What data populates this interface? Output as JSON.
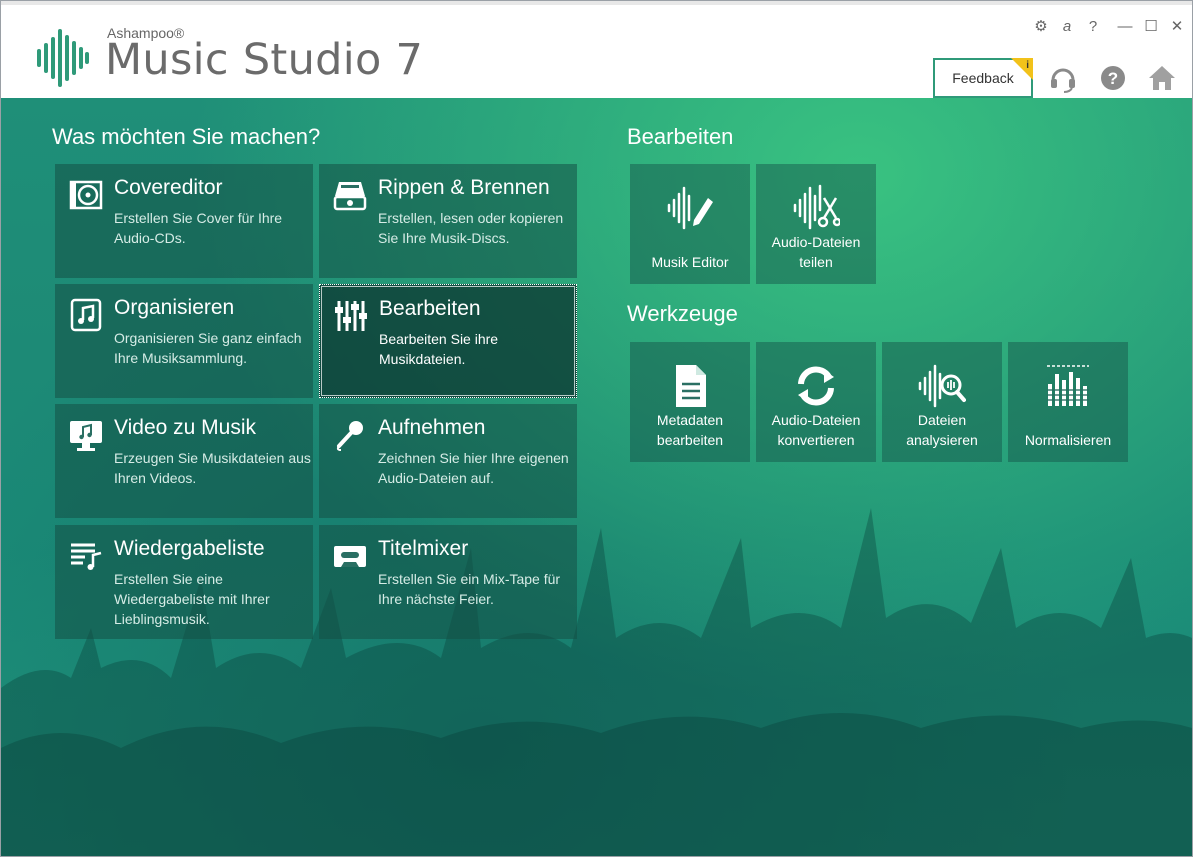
{
  "app": {
    "brand_small": "Ashampoo®",
    "brand_big": "Music Studio 7",
    "accent": "#2f9a79",
    "badge_color": "#f2c21a"
  },
  "window_controls": {
    "settings": "⚙",
    "account": "a",
    "help": "?",
    "minimize": "—",
    "maximize": "☐",
    "close": "✕"
  },
  "header": {
    "feedback_label": "Feedback",
    "feedback_badge": "i"
  },
  "left": {
    "title": "Was möchten Sie machen?",
    "tiles": [
      {
        "title": "Covereditor",
        "desc": "Erstellen Sie Cover für Ihre Audio-CDs.",
        "icon": "cd-cover-icon"
      },
      {
        "title": "Rippen & Brennen",
        "desc": "Erstellen, lesen oder kopieren Sie Ihre Musik-Discs.",
        "icon": "disc-drive-icon"
      },
      {
        "title": "Organisieren",
        "desc": "Organisieren Sie ganz einfach Ihre Musiksammlung.",
        "icon": "music-file-icon"
      },
      {
        "title": "Bearbeiten",
        "desc": "Bearbeiten Sie ihre Musikdateien.",
        "icon": "equalizer-sliders-icon"
      },
      {
        "title": "Video zu Musik",
        "desc": "Erzeugen Sie Musikdateien aus Ihren Videos.",
        "icon": "monitor-music-icon"
      },
      {
        "title": "Aufnehmen",
        "desc": "Zeichnen Sie hier Ihre eigenen Audio-Dateien auf.",
        "icon": "microphone-icon"
      },
      {
        "title": "Wiedergabeliste",
        "desc": "Erstellen Sie eine Wiedergabeliste mit Ihrer Lieblingsmusik.",
        "icon": "playlist-icon"
      },
      {
        "title": "Titelmixer",
        "desc": "Erstellen Sie ein Mix-Tape für Ihre nächste Feier.",
        "icon": "cassette-icon"
      }
    ]
  },
  "edit": {
    "title": "Bearbeiten",
    "tiles": [
      {
        "label": "Musik Editor",
        "icon": "waveform-pen-icon"
      },
      {
        "label": "Audio-Dateien teilen",
        "icon": "waveform-scissors-icon"
      }
    ]
  },
  "tools": {
    "title": "Werkzeuge",
    "tiles": [
      {
        "label": "Metadaten bearbeiten",
        "icon": "document-icon"
      },
      {
        "label": "Audio-Dateien konvertieren",
        "icon": "refresh-icon"
      },
      {
        "label": "Dateien analysieren",
        "icon": "waveform-magnifier-icon"
      },
      {
        "label": "Normalisieren",
        "icon": "level-bars-icon"
      }
    ]
  }
}
